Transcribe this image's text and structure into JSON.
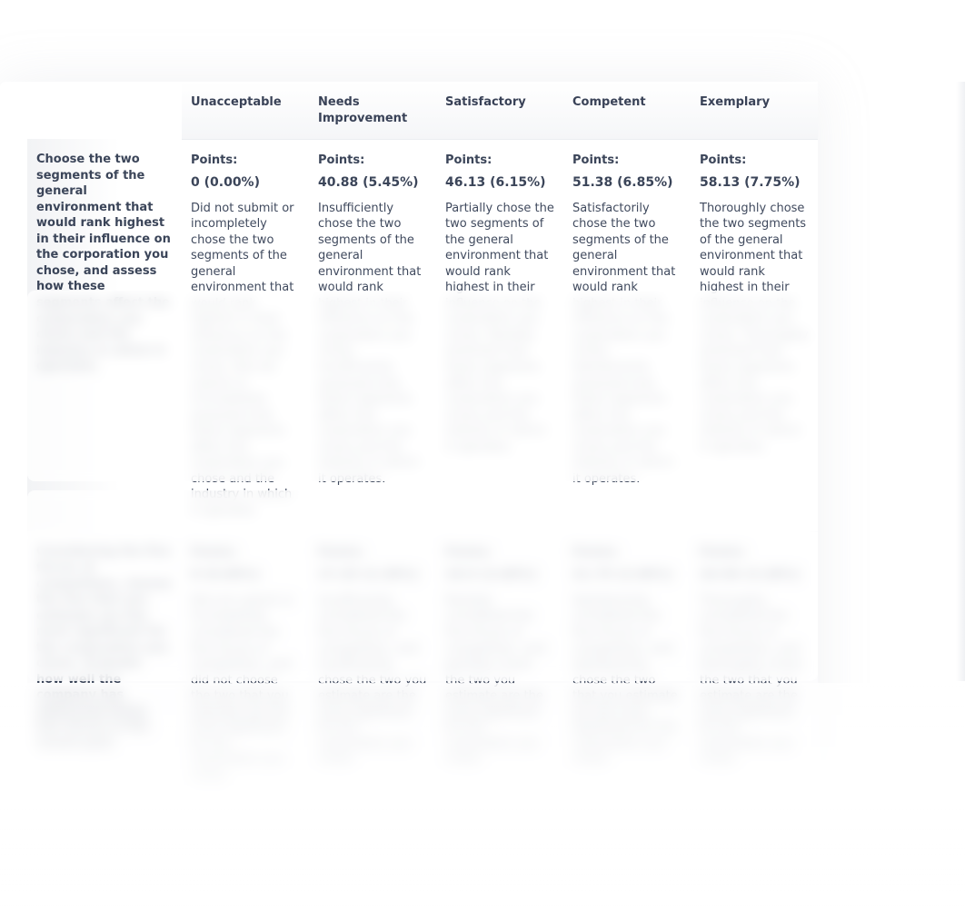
{
  "headers": {
    "corner": "",
    "lvl1": "Unacceptable",
    "lvl2": "Needs Improvement",
    "lvl3": "Satisfactory",
    "lvl4": "Competent",
    "lvl5": "Exemplary"
  },
  "row1": {
    "criterion": "Choose the two segments of the general environment that would rank highest in their influence on the corporation you chose, and assess how these segments affect the corporation you chose and the industry in which it operates.",
    "c1": {
      "points": "Points:",
      "range": "0 (0.00%)",
      "desc": "Did not submit or incompletely chose the two segments of the general environment that would rank highest in their influence on the corporation you chose. Did not submit or incompletely assessed how these segments affect the corporation you chose and the industry in which it operates."
    },
    "c2": {
      "points": "Points:",
      "range": "40.88 (5.45%)",
      "desc": "Insufficiently chose the two segments of the general environment that would rank highest in their influence on the corporation you chose. Insufficiently assessed how these segments affect the corporation you chose and the industry in which it operates."
    },
    "c3": {
      "points": "Points:",
      "range": "46.13 (6.15%)",
      "desc": "Partially chose the two segments of the general environment that would rank highest in their influence on the corporation you chose. Partially assessed how these segments affect the corporation you chose and the industry in which it operates."
    },
    "c4": {
      "points": "Points:",
      "range": "51.38 (6.85%)",
      "desc": "Satisfactorily chose the two segments of the general environment that would rank highest in their influence on the corporation you chose. Satisfactorily assessed how these segments affect the corporation you chose and the industry in which it operates."
    },
    "c5": {
      "points": "Points:",
      "range": "58.13 (7.75%)",
      "desc": "Thoroughly chose the two segments of the general environment that would rank highest in their influence on the corporation you chose. Thoroughly assessed how these segments affect the corporation you chose and the industry in which it operates."
    }
  },
  "row2": {
    "criterion": "Considering the five forces of competition, choose the two that you estimate are the most significant for the corporation you chose. Evaluate how well the company has addressed these two forces in the recent past.",
    "c1": {
      "points": "Points:",
      "range": "0 (0.00%)",
      "desc": "Did not submit or incompletely considered the five forces of competition, and did not choose the two that you estimate are the most significant for the corporation you chose."
    },
    "c2": {
      "points": "Points:",
      "range": "17.25 (2.30%)",
      "desc": "Insufficiently considered the five forces of competition, and insufficiently chose the two you estimate are the most significant for the corporation you chose."
    },
    "c3": {
      "points": "Points:",
      "range": "19.5 (2.60%)",
      "desc": "Partially considered the five forces of competition, and partially chose the two you estimate are the most significant for the corporation you chose."
    },
    "c4": {
      "points": "Points:",
      "range": "21.75 (2.90%)",
      "desc": "Satisfactorily considered the five forces of competition, and satisfactorily chose the two that you estimate are the most significant for the corporation you chose."
    },
    "c5": {
      "points": "Points:",
      "range": "24.56 (3.28%)",
      "desc": "Thoroughly considered the five forces of competition, and thoroughly chose the two that you estimate are the most significant for the corporation you chose."
    }
  }
}
